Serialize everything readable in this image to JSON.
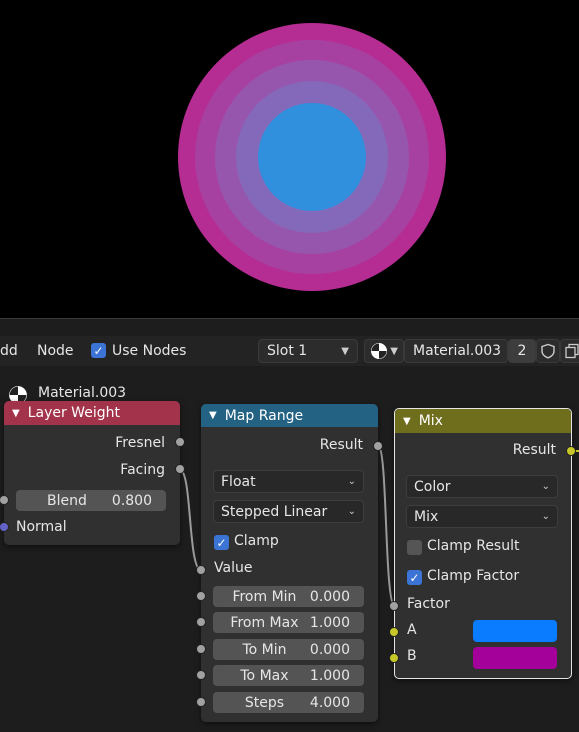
{
  "header": {
    "menu_add": "dd",
    "menu_node": "Node",
    "use_nodes_label": "Use Nodes",
    "use_nodes_checked": true,
    "slot": "Slot 1",
    "material_name": "Material.003",
    "user_count": "2"
  },
  "editor": {
    "breadcrumb_material": "Material.003"
  },
  "nodes": {
    "layer_weight": {
      "title": "Layer Weight",
      "color": "#a2334b",
      "out_fresnel": "Fresnel",
      "out_facing": "Facing",
      "blend_label": "Blend",
      "blend_value": "0.800",
      "in_normal": "Normal"
    },
    "map_range": {
      "title": "Map Range",
      "color": "#246283",
      "out_result": "Result",
      "data_type": "Float",
      "interpolation": "Stepped Linear",
      "clamp_label": "Clamp",
      "clamp_checked": true,
      "in_value": "Value",
      "fields": [
        {
          "label": "From Min",
          "value": "0.000"
        },
        {
          "label": "From Max",
          "value": "1.000"
        },
        {
          "label": "To Min",
          "value": "0.000"
        },
        {
          "label": "To Max",
          "value": "1.000"
        },
        {
          "label": "Steps",
          "value": "4.000"
        }
      ]
    },
    "mix": {
      "title": "Mix",
      "color": "#6e6e1d",
      "out_result": "Result",
      "data_type": "Color",
      "blend_mode": "Mix",
      "clamp_result_label": "Clamp Result",
      "clamp_result_checked": false,
      "clamp_factor_label": "Clamp Factor",
      "clamp_factor_checked": true,
      "in_factor": "Factor",
      "in_a": "A",
      "in_b": "B",
      "color_a": "#0a7cff",
      "color_b": "#a4009a"
    }
  },
  "preview": {
    "ring_colors": [
      "#b52c93",
      "#a741a1",
      "#9756ae",
      "#8469ba",
      "#6e7dc6",
      "#3090dd"
    ]
  }
}
